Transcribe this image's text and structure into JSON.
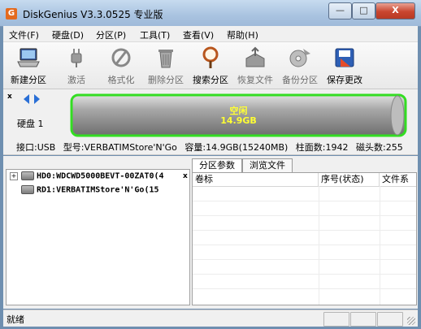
{
  "window": {
    "title": "DiskGenius V3.3.0525 专业版",
    "controls": {
      "minimize": "—",
      "maximize": "□",
      "close": "X"
    }
  },
  "menu": [
    "文件(F)",
    "硬盘(D)",
    "分区(P)",
    "工具(T)",
    "查看(V)",
    "帮助(H)"
  ],
  "toolbar": [
    {
      "label": "新建分区",
      "icon": "new-partition-icon",
      "enabled": true
    },
    {
      "label": "激活",
      "icon": "plug-icon",
      "enabled": false
    },
    {
      "label": "格式化",
      "icon": "format-icon",
      "enabled": false
    },
    {
      "label": "删除分区",
      "icon": "trash-icon",
      "enabled": false
    },
    {
      "label": "搜索分区",
      "icon": "magnifier-icon",
      "enabled": true
    },
    {
      "label": "恢复文件",
      "icon": "restore-files-icon",
      "enabled": false
    },
    {
      "label": "备份分区",
      "icon": "backup-disc-icon",
      "enabled": false
    },
    {
      "label": "保存更改",
      "icon": "save-changes-icon",
      "enabled": true
    }
  ],
  "disk_panel": {
    "close": "x",
    "disk_label": "硬盘 1",
    "partition_state": "空闲",
    "partition_size": "14.9GB",
    "info": {
      "interface": "接口:USB",
      "model": "型号:VERBATIMStore'N'Go",
      "capacity": "容量:14.9GB(15240MB)",
      "cylinders": "柱面数:1942",
      "heads": "磁头数:255"
    }
  },
  "tree": {
    "close": "x",
    "items": [
      {
        "expander": "+",
        "label": "HD0:WDCWD5000BEVT-00ZAT0(4"
      },
      {
        "expander": "",
        "label": "RD1:VERBATIMStore'N'Go(15"
      }
    ]
  },
  "tabs": [
    "分区参数",
    "浏览文件"
  ],
  "grid_columns": [
    "卷标",
    "序号(状态)",
    "文件系"
  ],
  "status": {
    "text": "就绪"
  }
}
